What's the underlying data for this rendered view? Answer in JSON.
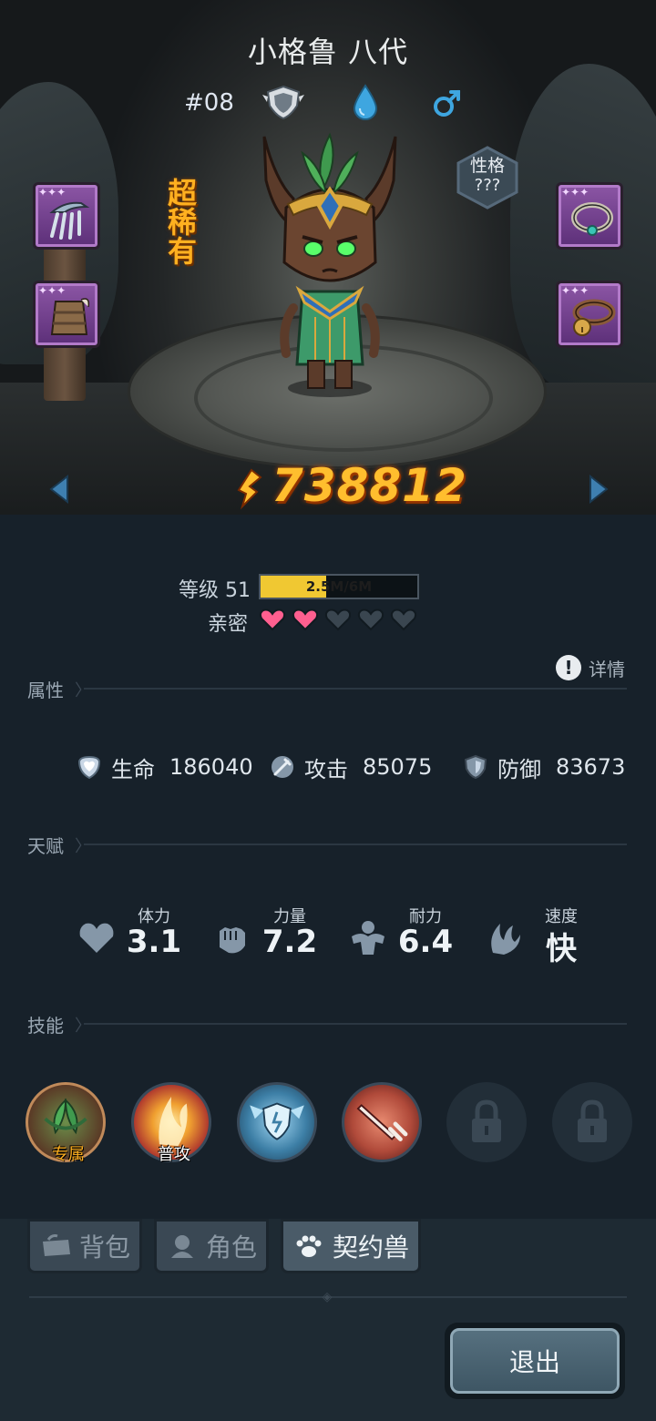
{
  "character": {
    "name": "小格鲁 八代",
    "id": "#08",
    "rarity": "超稀有",
    "personality_label": "性格",
    "personality_value": "???",
    "power": "738812"
  },
  "level": {
    "label": "等级 51",
    "exp_text": "2.5M/6M",
    "exp_fraction": 0.42
  },
  "affection": {
    "label": "亲密",
    "filled": 2,
    "total": 5
  },
  "details_label": "详情",
  "sections": {
    "attributes": "属性",
    "talents": "天赋",
    "skills": "技能"
  },
  "attributes": [
    {
      "name": "生命",
      "value": "186040",
      "icon": "hp-shield-icon"
    },
    {
      "name": "攻击",
      "value": "85075",
      "icon": "attack-sword-icon"
    },
    {
      "name": "防御",
      "value": "83673",
      "icon": "defense-shield-icon"
    }
  ],
  "talents": [
    {
      "name": "体力",
      "value": "3.1",
      "icon": "heart-icon"
    },
    {
      "name": "力量",
      "value": "7.2",
      "icon": "fist-icon"
    },
    {
      "name": "耐力",
      "value": "6.4",
      "icon": "muscle-icon"
    },
    {
      "name": "速度",
      "value": "快",
      "icon": "wing-icon"
    }
  ],
  "skills": [
    {
      "label": "专属",
      "type": "exclusive",
      "color": "#7a5a3a"
    },
    {
      "label": "普攻",
      "type": "normal-attack",
      "color": "#b03a2e"
    },
    {
      "label": "",
      "type": "shield",
      "color": "#3d7fa6"
    },
    {
      "label": "",
      "type": "sword",
      "color": "#b04a3a"
    },
    {
      "label": "",
      "type": "locked",
      "color": "#26323c"
    },
    {
      "label": "",
      "type": "locked",
      "color": "#26323c"
    }
  ],
  "tabs": [
    {
      "label": "背包",
      "icon": "bag-icon",
      "active": false
    },
    {
      "label": "角色",
      "icon": "character-icon",
      "active": false
    },
    {
      "label": "契约兽",
      "icon": "paw-icon",
      "active": true
    }
  ],
  "exit_label": "退出",
  "colors": {
    "power": "#ffbe2e",
    "rarity": "#ffb020",
    "heart_filled": "#ff5f8f",
    "heart_empty": "#3a4650",
    "exp_fill": "#f0c832"
  }
}
